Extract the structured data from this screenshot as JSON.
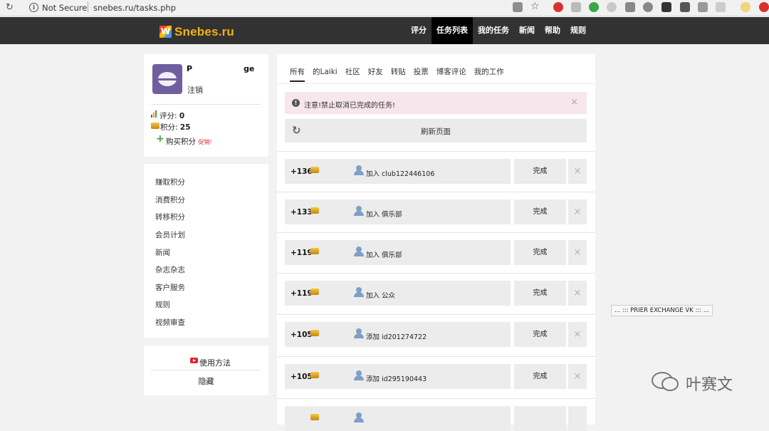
{
  "browser": {
    "security_label": "Not Secure",
    "url": "snebes.ru/tasks.php"
  },
  "site": {
    "logo_text": "Snebes.ru",
    "logo_mark": "W",
    "nav": [
      {
        "label": "评分",
        "active": false
      },
      {
        "label": "任务列表",
        "active": true
      },
      {
        "label": "我的任务",
        "active": false
      },
      {
        "label": "新闻",
        "active": false
      },
      {
        "label": "帮助",
        "active": false
      },
      {
        "label": "规则",
        "active": false
      }
    ]
  },
  "profile": {
    "username": "P",
    "username_tail": "ge",
    "logout": "注销",
    "rating_label": "评分:",
    "rating_value": "0",
    "points_label": "积分:",
    "points_value": "25",
    "buy_label": "购买积分",
    "promo": "促销!"
  },
  "side_menu": [
    "赚取积分",
    "消费积分",
    "转移积分",
    "会员计划",
    "新闻",
    "杂志杂志",
    "客户服务",
    "规则",
    "视频审查"
  ],
  "help": {
    "usage_label": "使用方法",
    "hide_label": "隐藏"
  },
  "main": {
    "tabs": [
      {
        "label": "所有",
        "active": true
      },
      {
        "label": "的Laiki",
        "active": false
      },
      {
        "label": "社区",
        "active": false
      },
      {
        "label": "好友",
        "active": false
      },
      {
        "label": "转贴",
        "active": false
      },
      {
        "label": "投票",
        "active": false
      },
      {
        "label": "博客评论",
        "active": false
      },
      {
        "label": "我的工作",
        "active": false
      }
    ],
    "notice": "注意!禁止取消已完成的任务!",
    "refresh_label": "刷新页面",
    "done_label": "完成",
    "tasks": [
      {
        "points": "+136",
        "action": "加入",
        "target": "club122446106",
        "icon": "group-icon"
      },
      {
        "points": "+133",
        "action": "加入",
        "target": "俱乐部",
        "icon": "group-icon"
      },
      {
        "points": "+119",
        "action": "加入",
        "target": "俱乐部",
        "icon": "group-icon"
      },
      {
        "points": "+119",
        "action": "加入",
        "target": "公众",
        "icon": "group-icon"
      },
      {
        "points": "+105",
        "action": "添加",
        "target": "id201274722",
        "icon": "user-icon"
      },
      {
        "points": "+105",
        "action": "添加",
        "target": "id295190443",
        "icon": "user-icon"
      }
    ]
  },
  "vk_widget": "... ::: PRIER EXCHANGE VK ::: ...",
  "watermark": "叶赛文",
  "colors": {
    "header_bg": "#323232",
    "logo_gold": "#f3b215",
    "notice_bg": "#f7e6ec",
    "promo_red": "#e0262f"
  }
}
